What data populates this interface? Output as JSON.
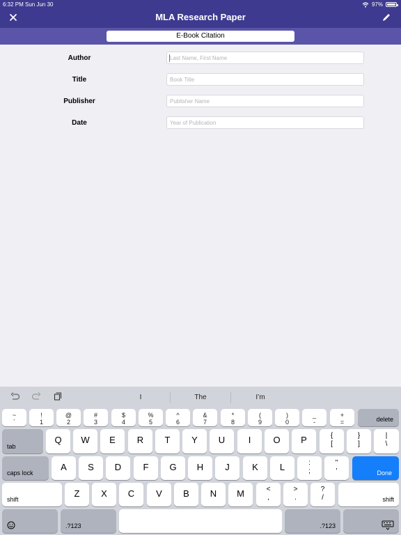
{
  "status": {
    "time": "6:32 PM",
    "date": "Sun Jun 30",
    "battery_percent": "97%",
    "battery_level": 0.97,
    "wifi_icon": "wifi-icon"
  },
  "nav": {
    "title": "MLA Research Paper",
    "close_icon": "close-icon",
    "edit_icon": "pencil-icon"
  },
  "segment": {
    "label": "E-Book Citation"
  },
  "form": {
    "fields": [
      {
        "label": "Author",
        "placeholder": "Last Name, First Name"
      },
      {
        "label": "Title",
        "placeholder": "Book Title"
      },
      {
        "label": "Publisher",
        "placeholder": "Publisher Name"
      },
      {
        "label": "Date",
        "placeholder": "Year of Publication"
      }
    ]
  },
  "keyboard": {
    "tools": [
      "undo-icon",
      "redo-icon",
      "paste-icon"
    ],
    "suggestions": [
      "I",
      "The",
      "I’m"
    ],
    "number_row": [
      {
        "top": "~",
        "bot": "`"
      },
      {
        "top": "!",
        "bot": "1"
      },
      {
        "top": "@",
        "bot": "2"
      },
      {
        "top": "#",
        "bot": "3"
      },
      {
        "top": "$",
        "bot": "4"
      },
      {
        "top": "%",
        "bot": "5"
      },
      {
        "top": "^",
        "bot": "6"
      },
      {
        "top": "&",
        "bot": "7"
      },
      {
        "top": "*",
        "bot": "8"
      },
      {
        "top": "(",
        "bot": "9"
      },
      {
        "top": ")",
        "bot": "0"
      },
      {
        "top": "_",
        "bot": "-"
      },
      {
        "top": "+",
        "bot": "="
      }
    ],
    "delete": "delete",
    "tab": "tab",
    "row_q": [
      "Q",
      "W",
      "E",
      "R",
      "T",
      "Y",
      "U",
      "I",
      "O",
      "P"
    ],
    "row_q_sym": [
      {
        "top": "{",
        "bot": "["
      },
      {
        "top": "}",
        "bot": "]"
      },
      {
        "top": "|",
        "bot": "\\"
      }
    ],
    "caps": "caps lock",
    "row_a": [
      "A",
      "S",
      "D",
      "F",
      "G",
      "H",
      "J",
      "K",
      "L"
    ],
    "row_a_sym": [
      {
        "top": ":",
        "bot": ";"
      },
      {
        "top": "\"",
        "bot": "'"
      }
    ],
    "done": "Done",
    "shift": "shift",
    "row_z": [
      "Z",
      "X",
      "C",
      "V",
      "B",
      "N",
      "M"
    ],
    "row_z_sym": [
      {
        "top": "<",
        "bot": ","
      },
      {
        "top": ">",
        "bot": "."
      },
      {
        "top": "?",
        "bot": "/"
      }
    ],
    "emoji_icon": "emoji-icon",
    "numbers": ".?123",
    "dismiss_icon": "keyboard-dismiss-icon"
  }
}
